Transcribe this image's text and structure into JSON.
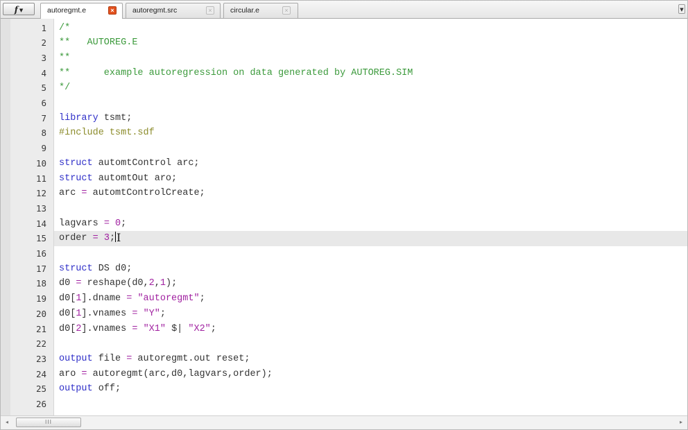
{
  "toolbar": {
    "function_button_label": "f",
    "function_button_icon": "dropdown-caret-icon",
    "overflow_icon": "chevron-down-icon"
  },
  "tabs": [
    {
      "label": "autoregmt.e",
      "active": true,
      "close_glyph": "×"
    },
    {
      "label": "autoregmt.src",
      "active": false,
      "close_glyph": "×"
    },
    {
      "label": "circular.e",
      "active": false,
      "close_glyph": "×"
    }
  ],
  "colors": {
    "comment": "#3c9a3c",
    "keyword": "#2f2fc8",
    "preprocessor": "#8c8c2c",
    "string": "#a020a0",
    "current_line": "#e8e8e8",
    "active_tab_close": "#e2521f"
  },
  "editor": {
    "current_line": 15,
    "lines": [
      {
        "n": "1",
        "tokens": [
          [
            "comment",
            "/*"
          ]
        ]
      },
      {
        "n": "2",
        "tokens": [
          [
            "comment",
            "**   AUTOREG.E"
          ]
        ]
      },
      {
        "n": "3",
        "tokens": [
          [
            "comment",
            "**"
          ]
        ]
      },
      {
        "n": "4",
        "tokens": [
          [
            "comment",
            "**      example autoregression on data generated by AUTOREG.SIM"
          ]
        ]
      },
      {
        "n": "5",
        "tokens": [
          [
            "comment",
            "*/"
          ]
        ]
      },
      {
        "n": "6",
        "tokens": []
      },
      {
        "n": "7",
        "tokens": [
          [
            "keyword",
            "library"
          ],
          [
            "default",
            " tsmt;"
          ]
        ]
      },
      {
        "n": "8",
        "tokens": [
          [
            "preproc",
            "#include tsmt.sdf"
          ]
        ]
      },
      {
        "n": "9",
        "tokens": []
      },
      {
        "n": "10",
        "tokens": [
          [
            "keyword",
            "struct"
          ],
          [
            "default",
            " automtControl arc;"
          ]
        ]
      },
      {
        "n": "11",
        "tokens": [
          [
            "keyword",
            "struct"
          ],
          [
            "default",
            " automtOut aro;"
          ]
        ]
      },
      {
        "n": "12",
        "tokens": [
          [
            "default",
            "arc "
          ],
          [
            "operator",
            "="
          ],
          [
            "default",
            " automtControlCreate;"
          ]
        ]
      },
      {
        "n": "13",
        "tokens": []
      },
      {
        "n": "14",
        "tokens": [
          [
            "default",
            "lagvars "
          ],
          [
            "operator",
            "="
          ],
          [
            "default",
            " "
          ],
          [
            "number",
            "0"
          ],
          [
            "default",
            ";"
          ]
        ]
      },
      {
        "n": "15",
        "tokens": [
          [
            "default",
            "order "
          ],
          [
            "operator",
            "="
          ],
          [
            "default",
            " "
          ],
          [
            "number",
            "3"
          ],
          [
            "default",
            ";"
          ]
        ]
      },
      {
        "n": "16",
        "tokens": []
      },
      {
        "n": "17",
        "tokens": [
          [
            "keyword",
            "struct"
          ],
          [
            "default",
            " DS d0;"
          ]
        ]
      },
      {
        "n": "18",
        "tokens": [
          [
            "default",
            "d0 "
          ],
          [
            "operator",
            "="
          ],
          [
            "default",
            " reshape(d0,"
          ],
          [
            "number",
            "2"
          ],
          [
            "default",
            ","
          ],
          [
            "number",
            "1"
          ],
          [
            "default",
            ");"
          ]
        ]
      },
      {
        "n": "19",
        "tokens": [
          [
            "default",
            "d0["
          ],
          [
            "number",
            "1"
          ],
          [
            "default",
            "].dname "
          ],
          [
            "operator",
            "="
          ],
          [
            "default",
            " "
          ],
          [
            "string",
            "\"autoregmt\""
          ],
          [
            "default",
            ";"
          ]
        ]
      },
      {
        "n": "20",
        "tokens": [
          [
            "default",
            "d0["
          ],
          [
            "number",
            "1"
          ],
          [
            "default",
            "].vnames "
          ],
          [
            "operator",
            "="
          ],
          [
            "default",
            " "
          ],
          [
            "string",
            "\"Y\""
          ],
          [
            "default",
            ";"
          ]
        ]
      },
      {
        "n": "21",
        "tokens": [
          [
            "default",
            "d0["
          ],
          [
            "number",
            "2"
          ],
          [
            "default",
            "].vnames "
          ],
          [
            "operator",
            "="
          ],
          [
            "default",
            " "
          ],
          [
            "string",
            "\"X1\""
          ],
          [
            "default",
            " $| "
          ],
          [
            "string",
            "\"X2\""
          ],
          [
            "default",
            ";"
          ]
        ]
      },
      {
        "n": "22",
        "tokens": []
      },
      {
        "n": "23",
        "tokens": [
          [
            "keyword",
            "output"
          ],
          [
            "default",
            " file "
          ],
          [
            "operator",
            "="
          ],
          [
            "default",
            " autoregmt.out reset;"
          ]
        ]
      },
      {
        "n": "24",
        "tokens": [
          [
            "default",
            "aro "
          ],
          [
            "operator",
            "="
          ],
          [
            "default",
            " autoregmt(arc,d0,lagvars,order);"
          ]
        ]
      },
      {
        "n": "25",
        "tokens": [
          [
            "keyword",
            "output"
          ],
          [
            "default",
            " off;"
          ]
        ]
      },
      {
        "n": "26",
        "tokens": []
      }
    ]
  },
  "scrollbar": {
    "left_arrow": "◂",
    "right_arrow": "▸",
    "thumb_grip": "III"
  }
}
